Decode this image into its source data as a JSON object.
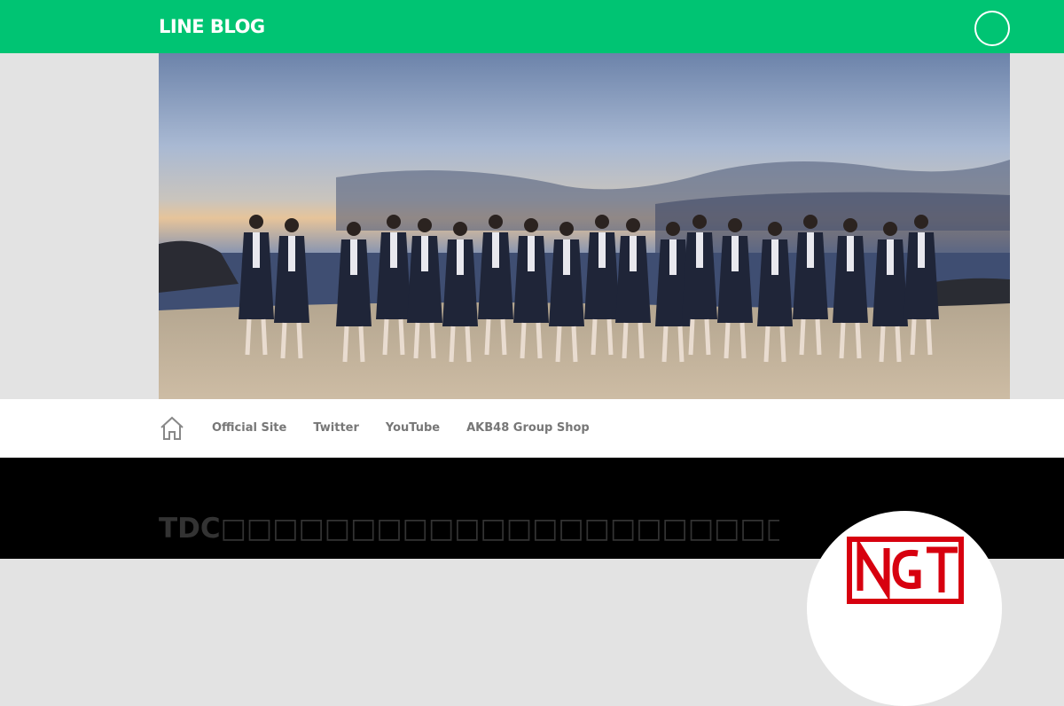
{
  "header": {
    "logo_text": "LINE BLOG",
    "brand_color": "#00c473"
  },
  "hero": {
    "image_desc": "group-photo-beach-sunset"
  },
  "nav": {
    "home_icon": "home-icon",
    "links": [
      "Official Site",
      "Twitter",
      "YouTube",
      "AKB48 Group Shop"
    ]
  },
  "blog": {
    "title": "TDC□□□□□□□□□□□□□□□□□□□□□□□□□□",
    "avatar_logo": "NGT"
  },
  "colors": {
    "header_green": "#00c473",
    "nav_text": "#777777",
    "dark_bg": "#000000",
    "title_text": "#333333",
    "logo_red": "#d7000f"
  }
}
